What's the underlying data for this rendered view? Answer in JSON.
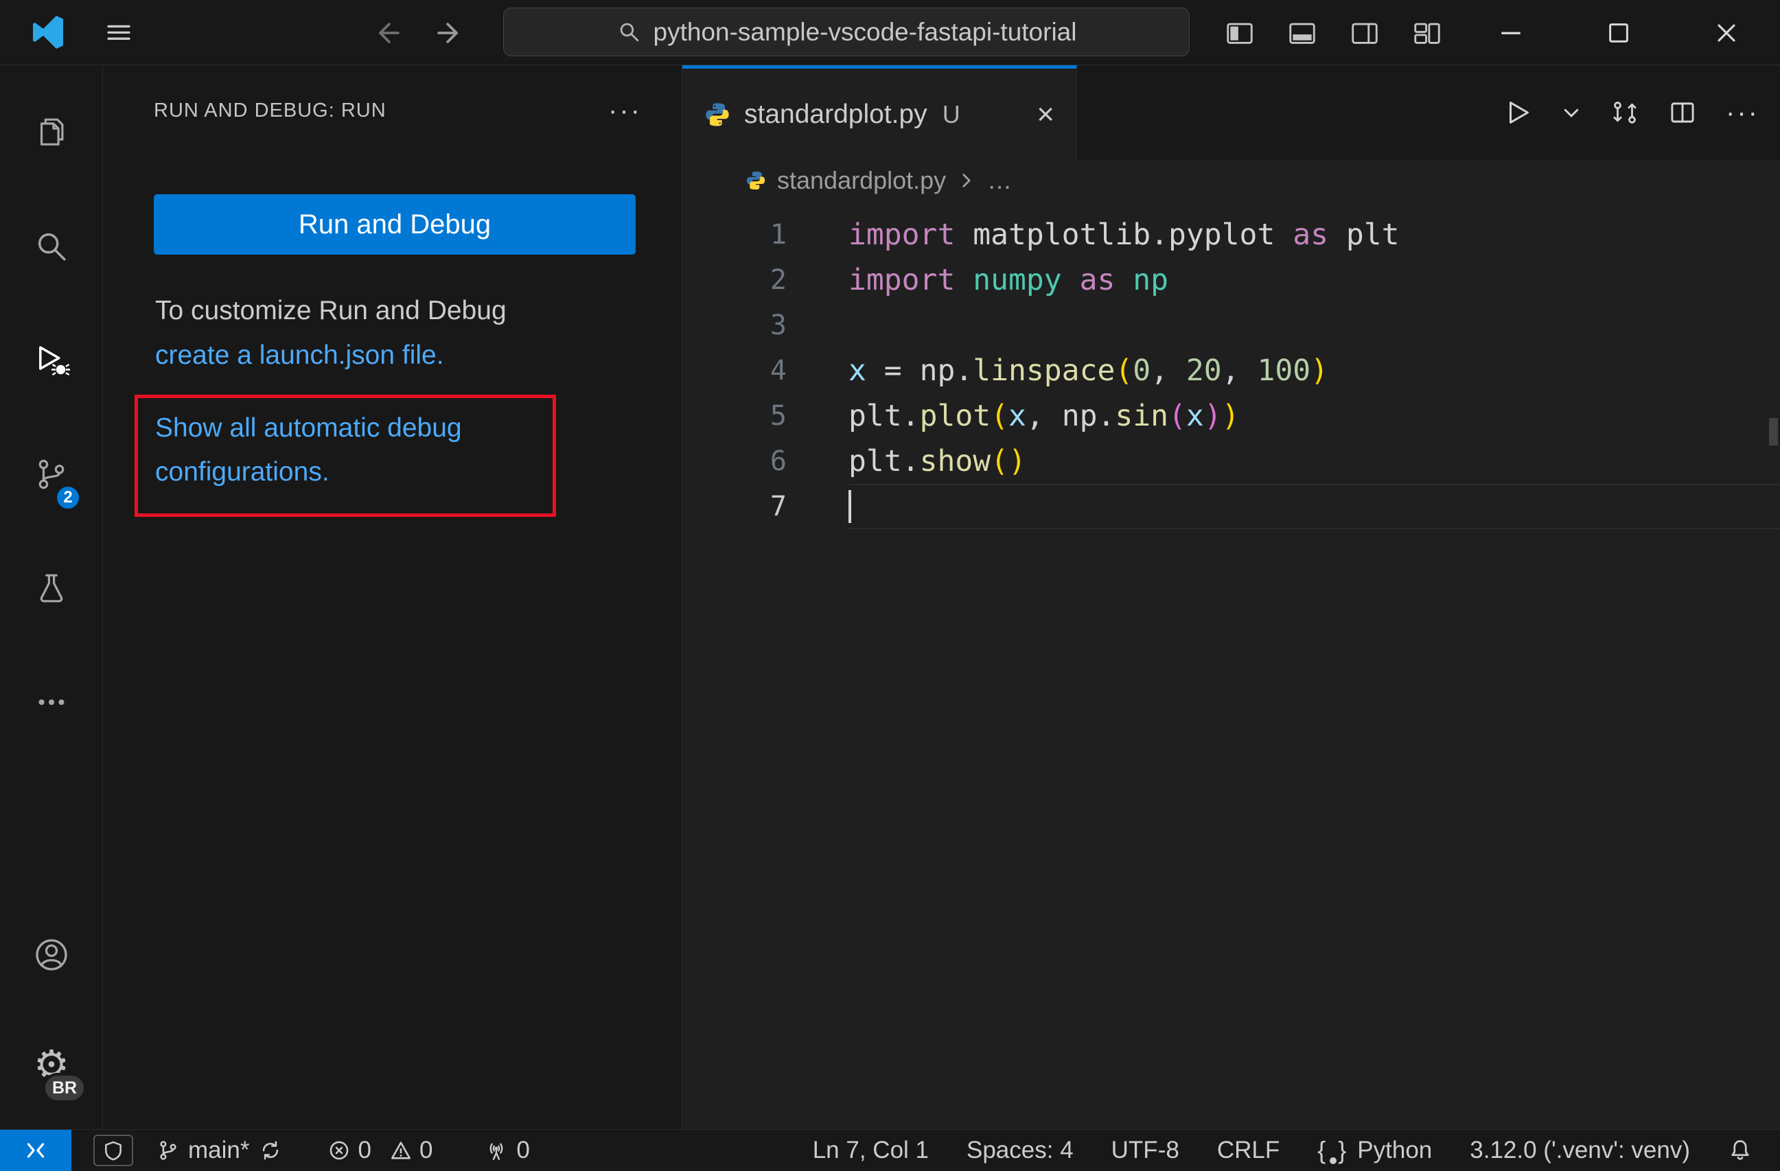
{
  "colors": {
    "accent_blue": "#0078d4",
    "link_blue": "#4daafc",
    "highlight_red": "#e81123",
    "titlebar_bg": "#181818",
    "editor_bg": "#1f1f1f",
    "badge_blue": "#0078d4"
  },
  "title_bar": {
    "search_value": "python-sample-vscode-fastapi-tutorial"
  },
  "activity_bar": {
    "source_control_badge": "2",
    "profile_badge": "BR",
    "more_label": "···",
    "gear_glyph": "⚙"
  },
  "sidebar": {
    "header": "RUN AND DEBUG: RUN",
    "more_label": "···",
    "run_button": "Run and Debug",
    "customize_line": "To customize Run and Debug",
    "launch_link": "create a launch.json file.",
    "auto_config_link": "Show all automatic debug configurations."
  },
  "editor": {
    "tab": {
      "file": "standardplot.py",
      "git_status": "U",
      "close": "×"
    },
    "toolbar": {
      "more_label": "···"
    },
    "breadcrumb": {
      "file": "standardplot.py",
      "ellipsis": "…"
    },
    "code": {
      "lines": [
        {
          "n": "1",
          "tokens": [
            [
              "kw",
              "import"
            ],
            [
              "pl",
              " matplotlib.pyplot"
            ],
            [
              "kw",
              " as"
            ],
            [
              "pl",
              " plt"
            ]
          ]
        },
        {
          "n": "2",
          "tokens": [
            [
              "kw",
              "import"
            ],
            [
              "md",
              " numpy"
            ],
            [
              "kw",
              " as"
            ],
            [
              "md",
              " np"
            ]
          ]
        },
        {
          "n": "3",
          "tokens": []
        },
        {
          "n": "4",
          "tokens": [
            [
              "vr",
              "x"
            ],
            [
              "pl",
              " = "
            ],
            [
              "pl",
              "np."
            ],
            [
              "fn",
              "linspace"
            ],
            [
              "p1",
              "("
            ],
            [
              "nm",
              "0"
            ],
            [
              "pl",
              ", "
            ],
            [
              "nm",
              "20"
            ],
            [
              "pl",
              ", "
            ],
            [
              "nm",
              "100"
            ],
            [
              "p1",
              ")"
            ]
          ]
        },
        {
          "n": "5",
          "tokens": [
            [
              "pl",
              "plt."
            ],
            [
              "fn",
              "plot"
            ],
            [
              "p1",
              "("
            ],
            [
              "vr",
              "x"
            ],
            [
              "pl",
              ", "
            ],
            [
              "pl",
              "np."
            ],
            [
              "fn",
              "sin"
            ],
            [
              "p2",
              "("
            ],
            [
              "vr",
              "x"
            ],
            [
              "p2",
              ")"
            ],
            [
              "p1",
              ")"
            ]
          ]
        },
        {
          "n": "6",
          "tokens": [
            [
              "pl",
              "plt."
            ],
            [
              "fn",
              "show"
            ],
            [
              "p1",
              "("
            ],
            [
              "p1",
              ")"
            ]
          ]
        },
        {
          "n": "7",
          "tokens": [],
          "current": true,
          "cursor": true
        }
      ]
    }
  },
  "status_bar": {
    "branch": "main*",
    "errors": "0",
    "warnings": "0",
    "ports": "0",
    "cursor_position": "Ln 7, Col 1",
    "indentation": "Spaces: 4",
    "encoding": "UTF-8",
    "eol": "CRLF",
    "language": "Python",
    "interpreter": "3.12.0 ('.venv': venv)"
  }
}
